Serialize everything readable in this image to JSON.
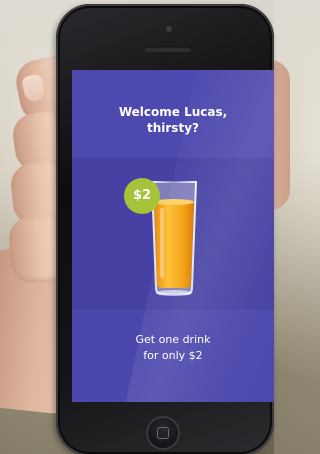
{
  "screen": {
    "welcome_text": "Welcome Lucas,\nthirsty?",
    "price_badge": "$2",
    "offer_text": "Get one drink\nfor only $2",
    "drink_icon": "juice-glass-icon"
  },
  "colors": {
    "screen_background": "#4a45a8",
    "badge_color": "#a6c439",
    "juice_color": "#f5a81c",
    "phone_body": "#0e0e10"
  }
}
